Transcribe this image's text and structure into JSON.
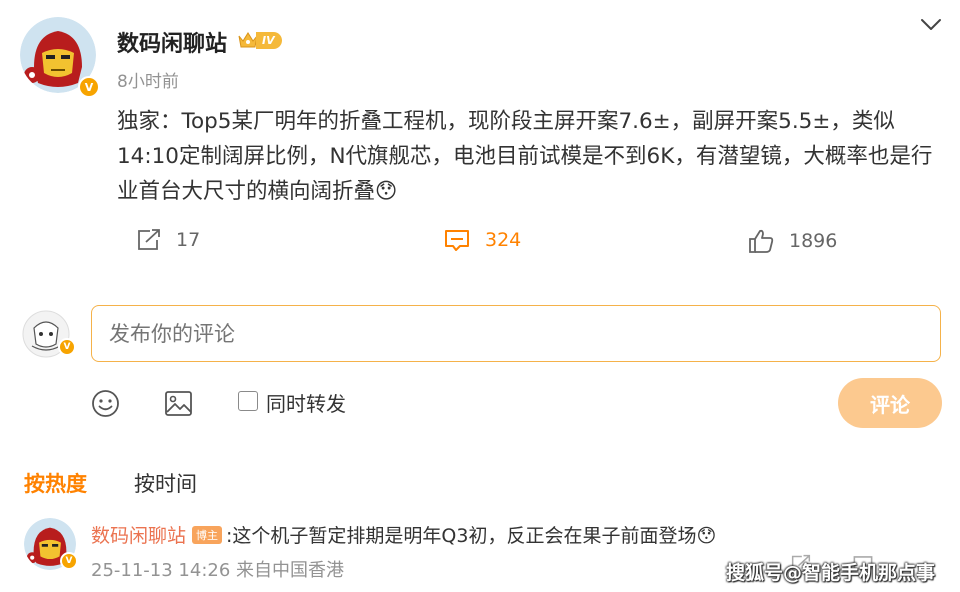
{
  "post": {
    "author": "数码闲聊站",
    "rank_level": "IV",
    "verified_mark": "V",
    "time": "8小时前",
    "text": "独家：Top5某厂明年的折叠工程机，现阶段主屏开案7.6±，副屏开案5.5±，类似14:10定制阔屏比例，N代旗舰芯，电池目前试模是不到6K，有潜望镜，大概率也是行业首台大尺寸的横向阔折叠😯",
    "actions": {
      "repost_count": "17",
      "comment_count": "324",
      "like_count": "1896"
    }
  },
  "composer": {
    "placeholder": "发布你的评论",
    "repost_label": "同时转发",
    "submit_label": "评论",
    "verified_mark": "V"
  },
  "sort": {
    "hot": "按热度",
    "time": "按时间"
  },
  "comments": [
    {
      "name": "数码闲聊站",
      "tag": "博主",
      "text": ":这个机子暂定排期是明年Q3初，反正会在果子前面登场😯",
      "date": "25-11-13 14:26",
      "location": "来自中国香港",
      "verified_mark": "V"
    }
  ],
  "watermark": "搜狐号@智能手机那点事",
  "colors": {
    "accent": "#ff8200",
    "input_border": "#f5b24a",
    "submit_bg": "#fcc98f",
    "verified": "#f7a400",
    "comment_name": "#eb7350"
  },
  "icons": [
    "chevron-down-icon",
    "repost-icon",
    "comment-icon",
    "like-icon",
    "emoji-icon",
    "image-icon",
    "crown-icon"
  ]
}
